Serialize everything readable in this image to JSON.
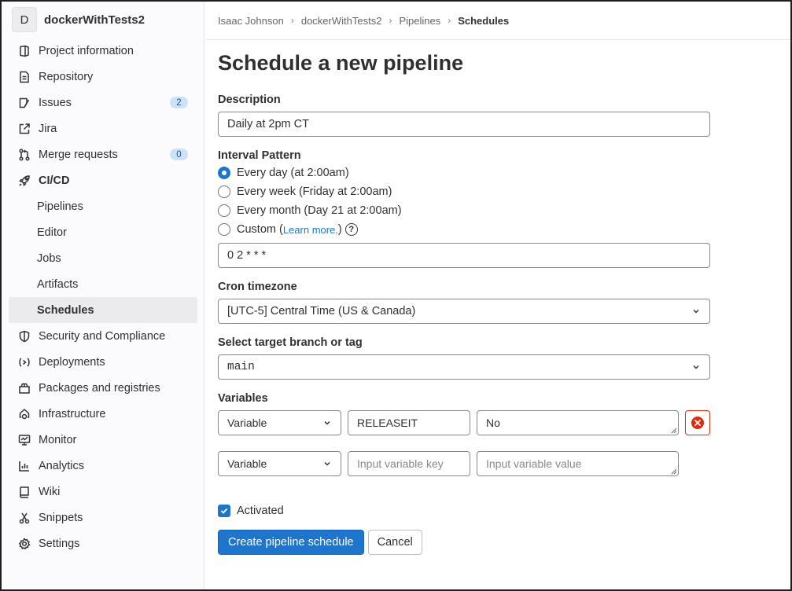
{
  "project": {
    "avatar_letter": "D",
    "name": "dockerWithTests2"
  },
  "sidebar": {
    "items": [
      {
        "label": "Project information",
        "icon": "project-icon"
      },
      {
        "label": "Repository",
        "icon": "doc-icon"
      },
      {
        "label": "Issues",
        "icon": "issues-icon",
        "badge": "2"
      },
      {
        "label": "Jira",
        "icon": "external-link-icon"
      },
      {
        "label": "Merge requests",
        "icon": "merge-request-icon",
        "badge": "0"
      },
      {
        "label": "CI/CD",
        "icon": "rocket-icon"
      },
      {
        "label": "Pipelines"
      },
      {
        "label": "Editor"
      },
      {
        "label": "Jobs"
      },
      {
        "label": "Artifacts"
      },
      {
        "label": "Schedules"
      },
      {
        "label": "Security and Compliance",
        "icon": "shield-icon"
      },
      {
        "label": "Deployments",
        "icon": "deployments-icon"
      },
      {
        "label": "Packages and registries",
        "icon": "package-icon"
      },
      {
        "label": "Infrastructure",
        "icon": "cloud-gear-icon"
      },
      {
        "label": "Monitor",
        "icon": "monitor-icon"
      },
      {
        "label": "Analytics",
        "icon": "chart-icon"
      },
      {
        "label": "Wiki",
        "icon": "book-icon"
      },
      {
        "label": "Snippets",
        "icon": "scissors-icon"
      },
      {
        "label": "Settings",
        "icon": "gear-icon"
      }
    ]
  },
  "breadcrumb": [
    "Isaac Johnson",
    "dockerWithTests2",
    "Pipelines",
    "Schedules"
  ],
  "page": {
    "title": "Schedule a new pipeline",
    "description_label": "Description",
    "description_value": "Daily at 2pm CT",
    "interval_label": "Interval Pattern",
    "interval_options": [
      "Every day (at 2:00am)",
      "Every week (Friday at 2:00am)",
      "Every month (Day 21 at 2:00am)"
    ],
    "custom_prefix": "Custom (",
    "custom_link": "Learn more.",
    "custom_suffix": ")",
    "cron_value": "0 2 * * *",
    "timezone_label": "Cron timezone",
    "timezone_value": "[UTC-5] Central Time (US & Canada)",
    "branch_label": "Select target branch or tag",
    "branch_value": "main",
    "variables_label": "Variables",
    "variables": [
      {
        "type": "Variable",
        "key": "RELEASEIT",
        "value": "No"
      }
    ],
    "new_variable": {
      "type": "Variable",
      "key_placeholder": "Input variable key",
      "value_placeholder": "Input variable value"
    },
    "activated_label": "Activated",
    "create_button": "Create pipeline schedule",
    "cancel_button": "Cancel"
  },
  "colors": {
    "primary": "#1f75cb",
    "danger": "#dd2b0e",
    "badge_bg": "#cbe2f9"
  }
}
